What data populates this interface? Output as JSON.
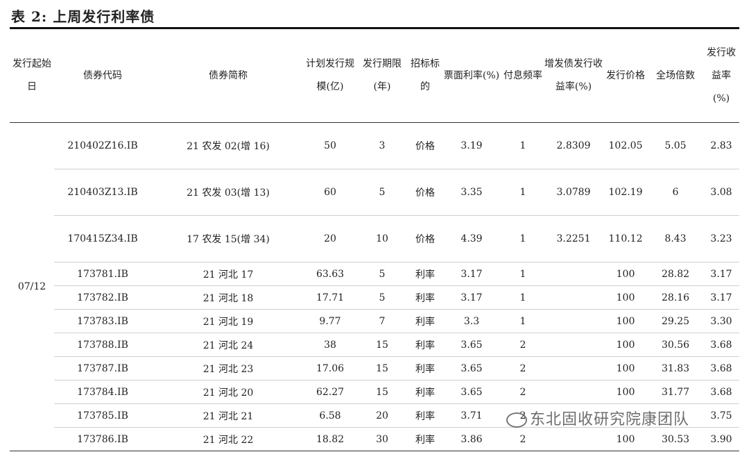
{
  "title": "表 2:  上周发行利率债",
  "headers": [
    "发行起始日",
    "债券代码",
    "债券简称",
    "计划发行规模(亿)",
    "发行期限(年)",
    "招标标的",
    "票面利率(%)",
    "付息频率",
    "增发债发行收益率(%)",
    "发行价格",
    "全场倍数",
    "发行收益率(%)"
  ],
  "date": "07/12",
  "rows": [
    {
      "code": "210402Z16.IB",
      "name": "21 农发 02(增 16)",
      "size": "50",
      "term": "3",
      "target": "价格",
      "coupon": "3.19",
      "freq": "1",
      "add_yield": "2.8309",
      "price": "102.05",
      "multiple": "5.05",
      "yield": "2.83"
    },
    {
      "code": "210403Z13.IB",
      "name": "21 农发 03(增 13)",
      "size": "60",
      "term": "5",
      "target": "价格",
      "coupon": "3.35",
      "freq": "1",
      "add_yield": "3.0789",
      "price": "102.19",
      "multiple": "6",
      "yield": "3.08"
    },
    {
      "code": "170415Z34.IB",
      "name": "17 农发 15(增 34)",
      "size": "20",
      "term": "10",
      "target": "价格",
      "coupon": "4.39",
      "freq": "1",
      "add_yield": "3.2251",
      "price": "110.12",
      "multiple": "8.43",
      "yield": "3.23"
    },
    {
      "code": "173781.IB",
      "name": "21 河北 17",
      "size": "63.63",
      "term": "5",
      "target": "利率",
      "coupon": "3.17",
      "freq": "1",
      "add_yield": "",
      "price": "100",
      "multiple": "28.82",
      "yield": "3.17"
    },
    {
      "code": "173782.IB",
      "name": "21 河北 18",
      "size": "17.71",
      "term": "5",
      "target": "利率",
      "coupon": "3.17",
      "freq": "1",
      "add_yield": "",
      "price": "100",
      "multiple": "28.16",
      "yield": "3.17"
    },
    {
      "code": "173783.IB",
      "name": "21 河北 19",
      "size": "9.77",
      "term": "7",
      "target": "利率",
      "coupon": "3.3",
      "freq": "1",
      "add_yield": "",
      "price": "100",
      "multiple": "29.25",
      "yield": "3.30"
    },
    {
      "code": "173788.IB",
      "name": "21 河北 24",
      "size": "38",
      "term": "15",
      "target": "利率",
      "coupon": "3.65",
      "freq": "2",
      "add_yield": "",
      "price": "100",
      "multiple": "30.56",
      "yield": "3.68"
    },
    {
      "code": "173787.IB",
      "name": "21 河北 23",
      "size": "17.06",
      "term": "15",
      "target": "利率",
      "coupon": "3.65",
      "freq": "2",
      "add_yield": "",
      "price": "100",
      "multiple": "31.83",
      "yield": "3.68"
    },
    {
      "code": "173784.IB",
      "name": "21 河北 20",
      "size": "62.27",
      "term": "15",
      "target": "利率",
      "coupon": "3.65",
      "freq": "2",
      "add_yield": "",
      "price": "100",
      "multiple": "31.77",
      "yield": "3.68"
    },
    {
      "code": "173785.IB",
      "name": "21 河北 21",
      "size": "6.58",
      "term": "20",
      "target": "利率",
      "coupon": "3.71",
      "freq": "2",
      "add_yield": "",
      "price": "",
      "multiple": "",
      "yield": "3.75"
    },
    {
      "code": "173786.IB",
      "name": "21 河北 22",
      "size": "18.82",
      "term": "30",
      "target": "利率",
      "coupon": "3.86",
      "freq": "2",
      "add_yield": "",
      "price": "100",
      "multiple": "30.53",
      "yield": "3.90"
    }
  ],
  "watermark": "东北固收研究院康团队"
}
